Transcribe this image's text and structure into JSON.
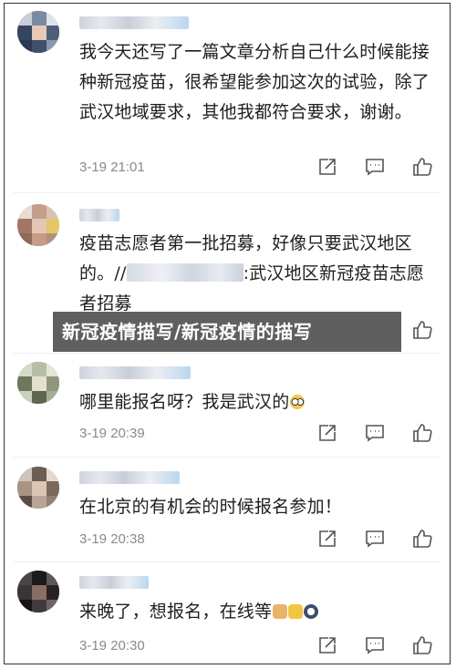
{
  "comments": [
    {
      "text": "我今天还写了一篇文章分析自己什么时候能接种新冠疫苗，很希望能参加这次的试验，除了武汉地域要求，其他我都符合要求，谢谢。",
      "time": "3-19 21:01"
    },
    {
      "text_before": "疫苗志愿者第一批招募，好像只要武汉地区的。//",
      "text_after": ":武汉地区新冠疫苗志愿者招募",
      "time": ""
    },
    {
      "text": "哪里能报名呀？我是武汉的",
      "time": "3-19 20:39"
    },
    {
      "text": "在北京的有机会的时候报名参加！",
      "time": "3-19 20:38"
    },
    {
      "text": "来晚了，想报名，在线等",
      "time": "3-19 20:30"
    }
  ],
  "overlay": {
    "caption": "新冠疫情描写/新冠疫情的描写"
  },
  "icons": {
    "share": "share-icon",
    "reply": "comment-icon",
    "like": "thumbs-up-icon"
  }
}
